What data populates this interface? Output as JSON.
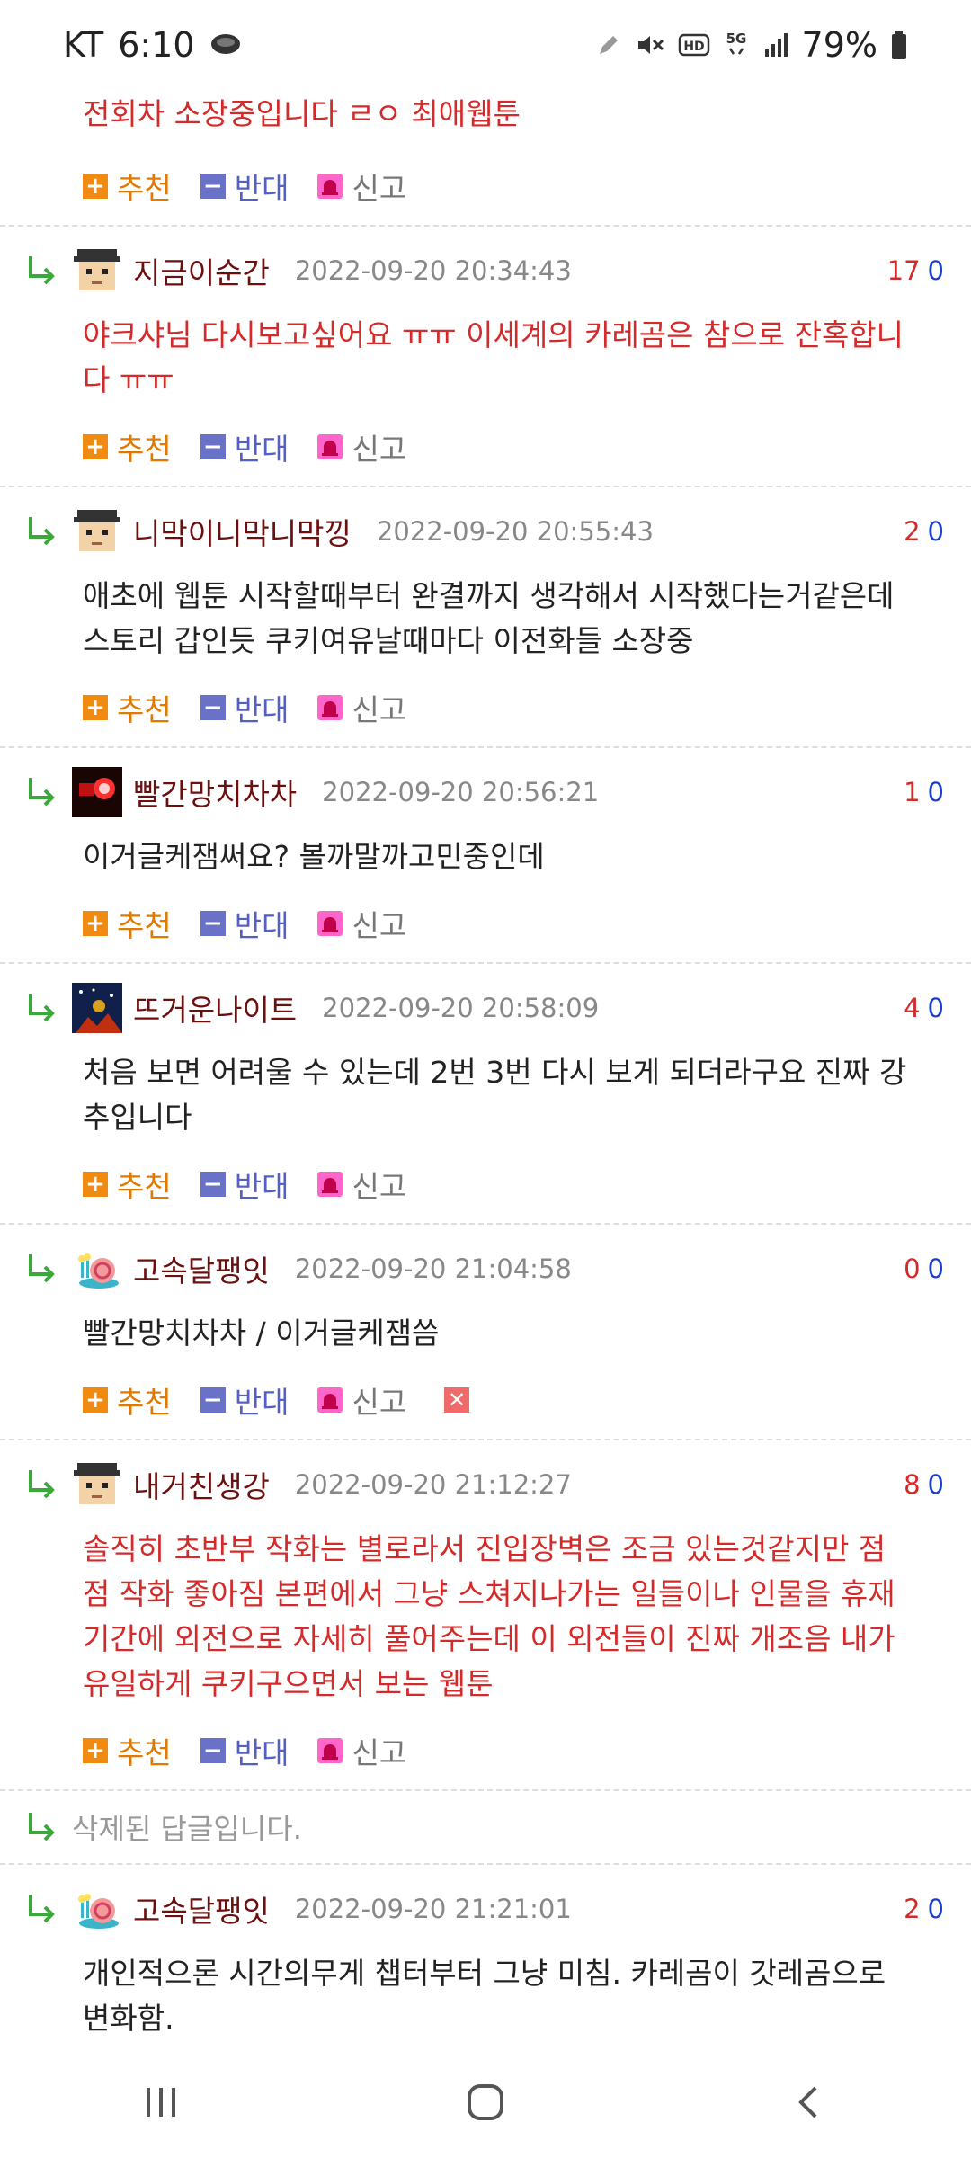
{
  "status": {
    "carrier": "KT",
    "time": "6:10",
    "battery": "79%",
    "icons": [
      "chat-bubble-icon",
      "pencil-icon",
      "mute-icon",
      "hd-icon",
      "5g-icon",
      "signal-icon",
      "battery-icon"
    ]
  },
  "top_comment": {
    "text": "전회차 소장중입니다 ㄹㅇ 최애웹툰"
  },
  "labels": {
    "recommend": "추천",
    "oppose": "반대",
    "report": "신고"
  },
  "comments": [
    {
      "nick": "지금이순간",
      "time": "2022-09-20 20:34:43",
      "up": "17",
      "down": "0",
      "text": "야크샤님 다시보고싶어요 ㅠㅠ 이세계의 카레곰은 참으로 잔혹합니다 ㅠㅠ",
      "color": "red",
      "avatar": "pixel-face-avatar"
    },
    {
      "nick": "니막이니막니막낑",
      "time": "2022-09-20 20:55:43",
      "up": "2",
      "down": "0",
      "text": "애초에 웹툰 시작할때부터 완결까지 생각해서 시작했다는거같은데 스토리 갑인듯 쿠키여유날때마다 이전화들 소장중",
      "color": "dark",
      "avatar": "pixel-face-avatar"
    },
    {
      "nick": "빨간망치차차",
      "time": "2022-09-20 20:56:21",
      "up": "1",
      "down": "0",
      "text": "이거글케잼써요? 볼까말까고민중인데",
      "color": "dark",
      "avatar": "red-glow-avatar"
    },
    {
      "nick": "뜨거운나이트",
      "time": "2022-09-20 20:58:09",
      "up": "4",
      "down": "0",
      "text": "처음 보면 어려울 수 있는데 2번 3번 다시 보게 되더라구요 진짜 강추입니다",
      "color": "dark",
      "avatar": "night-sky-avatar"
    },
    {
      "nick": "고속달팽잇",
      "time": "2022-09-20 21:04:58",
      "up": "0",
      "down": "0",
      "text": "빨간망치차차 / 이거글케잼씀",
      "color": "dark",
      "avatar": "snail-avatar",
      "deletable": true
    },
    {
      "nick": "내거친생강",
      "time": "2022-09-20 21:12:27",
      "up": "8",
      "down": "0",
      "text": "솔직히 초반부 작화는 별로라서 진입장벽은 조금 있는것같지만 점점 작화 좋아짐 본편에서 그냥 스쳐지나가는 일들이나 인물을 휴재기간에 외전으로 자세히 풀어주는데 이 외전들이 진짜 개조음 내가 유일하게 쿠키구으면서 보는 웹툰",
      "color": "red",
      "avatar": "pixel-face-avatar"
    }
  ],
  "deleted_reply": "삭제된 답글입니다.",
  "last_comment": {
    "nick": "고속달팽잇",
    "time": "2022-09-20 21:21:01",
    "up": "2",
    "down": "0",
    "text": "개인적으론 시간의무게 챕터부터 그냥 미침. 카레곰이 갓레곰으로 변화함.",
    "color": "dark",
    "avatar": "snail-avatar"
  },
  "colors": {
    "red_text": "#d42a2a",
    "nick": "#6b0f0f",
    "recommend": "#e07a00",
    "oppose": "#5560c4",
    "vote_down": "#1a3fd0"
  }
}
